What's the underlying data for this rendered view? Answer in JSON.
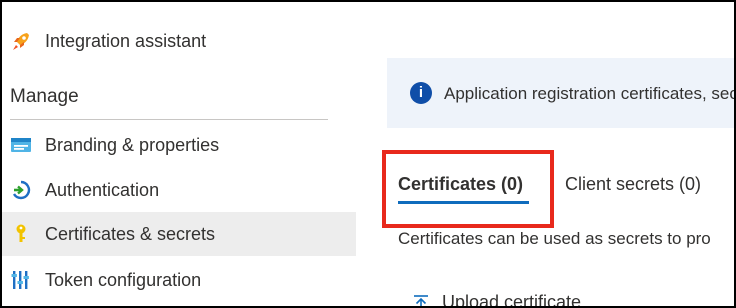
{
  "sidebar": {
    "integration": {
      "label": "Integration assistant",
      "icon": "rocket-icon"
    },
    "section_title": "Manage",
    "items": [
      {
        "label": "Branding & properties",
        "icon": "branding-icon"
      },
      {
        "label": "Authentication",
        "icon": "authentication-icon"
      },
      {
        "label": "Certificates & secrets",
        "icon": "key-icon",
        "selected": true
      },
      {
        "label": "Token configuration",
        "icon": "token-config-icon"
      }
    ]
  },
  "main": {
    "banner": {
      "text": "Application registration certificates, sec",
      "icon": "info-icon"
    },
    "tabs": [
      {
        "label": "Certificates (0)",
        "active": true
      },
      {
        "label": "Client secrets (0)",
        "active": false
      }
    ],
    "description": "Certificates can be used as secrets to pro",
    "upload_label": "Upload certificate"
  },
  "colors": {
    "accent": "#0f6cbd",
    "highlight": "#e8291c",
    "selected_bg": "#ededed",
    "banner_bg": "#eef3fa"
  }
}
